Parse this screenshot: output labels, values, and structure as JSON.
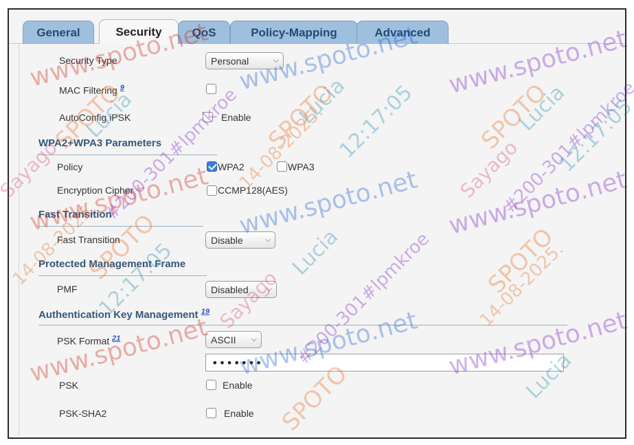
{
  "tabs": [
    {
      "label": "General",
      "active": false
    },
    {
      "label": "Security",
      "active": true
    },
    {
      "label": "QoS",
      "active": false
    },
    {
      "label": "Policy-Mapping",
      "active": false
    },
    {
      "label": "Advanced",
      "active": false
    }
  ],
  "security_type": {
    "label": "Security Type",
    "value": "Personal"
  },
  "mac_filtering": {
    "label": "MAC Filtering",
    "help_ref": "9",
    "checked": false
  },
  "autoconfig_ipsk": {
    "label": "AutoConfig iPSK",
    "option": "Enable",
    "checked": false
  },
  "wpa_params": {
    "title": "WPA2+WPA3 Parameters",
    "policy": {
      "label": "Policy",
      "wpa2": "WPA2",
      "wpa2_checked": true,
      "wpa3": "WPA3",
      "wpa3_checked": false
    },
    "encryption": {
      "label": "Encryption Cipher",
      "option": "CCMP128(AES)",
      "checked": false
    }
  },
  "fast_transition": {
    "title": "Fast Transition",
    "label": "Fast Transition",
    "value": "Disable"
  },
  "pmf": {
    "title": "Protected Management Frame",
    "label": "PMF",
    "value": "Disabled"
  },
  "akm": {
    "title": "Authentication Key Management",
    "help_ref": "19",
    "psk_format": {
      "label": "PSK Format",
      "help_ref": "21",
      "value": "ASCII"
    },
    "psk_key": {
      "value": "•••••••"
    },
    "psk": {
      "label": "PSK",
      "option": "Enable",
      "checked": false
    },
    "psk_sha2": {
      "label": "PSK-SHA2",
      "option": "Enable",
      "checked": false
    }
  },
  "watermark": {
    "site": "www.spoto.net",
    "brand": "SPOTO",
    "name": "Lucia",
    "user": "Sayago",
    "id": "#200-301#lpmkroe",
    "date": "14-08-2025.",
    "time": "12:17:05"
  },
  "colors": {
    "tab_inactive": "#9fbfdf",
    "section_title": "#35577a",
    "checkbox_checked": "#3b7fd6",
    "link": "#2a55c4"
  }
}
